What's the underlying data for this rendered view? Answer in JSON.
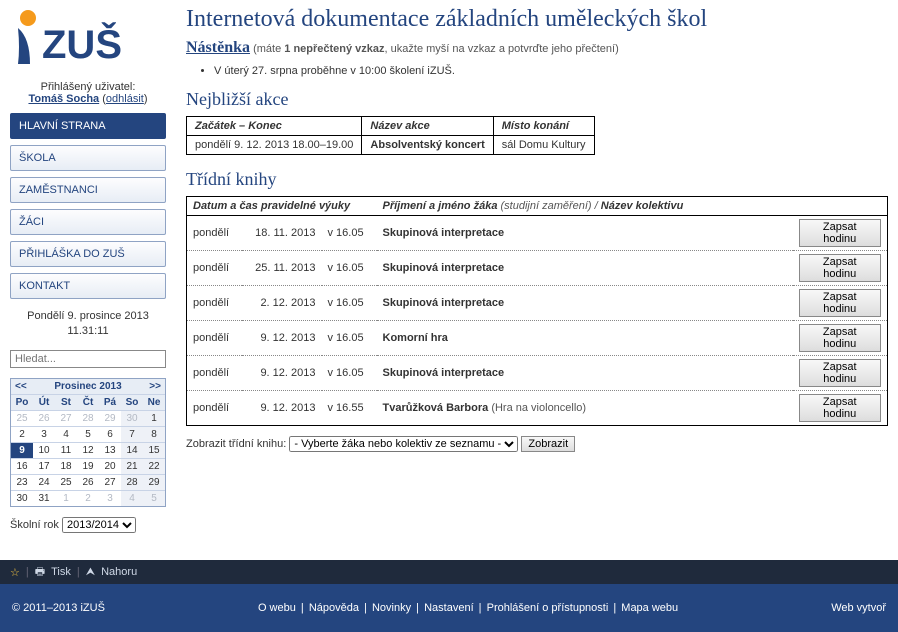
{
  "user": {
    "label": "Přihlášený uživatel:",
    "name": "Tomáš Socha",
    "logout": "odhlásit"
  },
  "nav": {
    "items": [
      {
        "label": "HLAVNÍ STRANA",
        "active": true
      },
      {
        "label": "ŠKOLA"
      },
      {
        "label": "ZAMĚSTNANCI"
      },
      {
        "label": "ŽÁCI"
      },
      {
        "label": "PŘIHLÁŠKA DO ZUŠ"
      },
      {
        "label": "KONTAKT"
      }
    ]
  },
  "datetime": {
    "date": "Pondělí 9. prosince 2013",
    "time": "11.31:11"
  },
  "search": {
    "placeholder": "Hledat..."
  },
  "calendar": {
    "title": "Prosinec 2013",
    "prev": "<<",
    "next": ">>",
    "dow": [
      "Po",
      "Út",
      "St",
      "Čt",
      "Pá",
      "So",
      "Ne"
    ],
    "cells": [
      {
        "n": "25",
        "out": true
      },
      {
        "n": "26",
        "out": true
      },
      {
        "n": "27",
        "out": true
      },
      {
        "n": "28",
        "out": true
      },
      {
        "n": "29",
        "out": true
      },
      {
        "n": "30",
        "out": true,
        "w": true
      },
      {
        "n": "1",
        "w": true
      },
      {
        "n": "2"
      },
      {
        "n": "3"
      },
      {
        "n": "4"
      },
      {
        "n": "5"
      },
      {
        "n": "6"
      },
      {
        "n": "7",
        "w": true
      },
      {
        "n": "8",
        "w": true
      },
      {
        "n": "9",
        "today": true
      },
      {
        "n": "10"
      },
      {
        "n": "11"
      },
      {
        "n": "12"
      },
      {
        "n": "13"
      },
      {
        "n": "14",
        "w": true
      },
      {
        "n": "15",
        "w": true
      },
      {
        "n": "16"
      },
      {
        "n": "17"
      },
      {
        "n": "18"
      },
      {
        "n": "19"
      },
      {
        "n": "20"
      },
      {
        "n": "21",
        "w": true
      },
      {
        "n": "22",
        "w": true
      },
      {
        "n": "23"
      },
      {
        "n": "24"
      },
      {
        "n": "25"
      },
      {
        "n": "26"
      },
      {
        "n": "27"
      },
      {
        "n": "28",
        "w": true
      },
      {
        "n": "29",
        "w": true
      },
      {
        "n": "30"
      },
      {
        "n": "31"
      },
      {
        "n": "1",
        "out": true
      },
      {
        "n": "2",
        "out": true
      },
      {
        "n": "3",
        "out": true
      },
      {
        "n": "4",
        "out": true,
        "w": true
      },
      {
        "n": "5",
        "out": true,
        "w": true
      }
    ]
  },
  "schoolyear": {
    "label": "Školní rok",
    "value": "2013/2014"
  },
  "page": {
    "title": "Internetová dokumentace základních uměleckých škol",
    "board_heading": "Nástěnka",
    "board_sub_pre": "(máte ",
    "board_sub_bold": "1 nepřečtený vzkaz",
    "board_sub_post": ", ukažte myší na vzkaz a potvrďte jeho přečtení)",
    "messages": [
      "V úterý 27. srpna proběhne v 10:00 školení iZUŠ."
    ],
    "events_heading": "Nejbližší akce",
    "events_cols": [
      "Začátek – Konec",
      "Název akce",
      "Místo konání"
    ],
    "events_rows": [
      {
        "time": "pondělí 9. 12. 2013 18.00–19.00",
        "name": "Absolventský koncert",
        "place": "sál Domu Kultury"
      }
    ],
    "books_heading": "Třídní knihy",
    "books_col1": "Datum a čas pravidelné výuky",
    "books_col2a": "Příjmení a jméno žáka",
    "books_col2b": "(studijní zaměření)",
    "books_col2c": "/ ",
    "books_col2d": "Název kolektivu",
    "books_rows": [
      {
        "day": "pondělí",
        "date": "18. 11. 2013",
        "time": "v 16.05",
        "name": "Skupinová interpretace"
      },
      {
        "day": "pondělí",
        "date": "25. 11. 2013",
        "time": "v 16.05",
        "name": "Skupinová interpretace"
      },
      {
        "day": "pondělí",
        "date": "2. 12. 2013",
        "time": "v 16.05",
        "name": "Skupinová interpretace"
      },
      {
        "day": "pondělí",
        "date": "9. 12. 2013",
        "time": "v 16.05",
        "name": "Komorní hra"
      },
      {
        "day": "pondělí",
        "date": "9. 12. 2013",
        "time": "v 16.05",
        "name": "Skupinová interpretace"
      },
      {
        "day": "pondělí",
        "date": "9. 12. 2013",
        "time": "v 16.55",
        "name": "Tvarůžková Barbora",
        "extra": "(Hra na violoncello)"
      }
    ],
    "write_btn": "Zapsat hodinu",
    "show_label": "Zobrazit třídní knihu:",
    "show_select": "- Vyberte žáka nebo kolektiv ze seznamu -",
    "show_btn": "Zobrazit"
  },
  "toolbar": {
    "star": "☆",
    "print_icon": "🖶",
    "print": "Tisk",
    "up_icon": "⮝",
    "up": "Nahoru"
  },
  "footer": {
    "copyright": "© 2011–2013 iZUŠ",
    "links": [
      "O webu",
      "Nápověda",
      "Novinky",
      "Nastavení",
      "Prohlášení o přístupnosti",
      "Mapa webu"
    ],
    "right": "Web vytvoř"
  }
}
